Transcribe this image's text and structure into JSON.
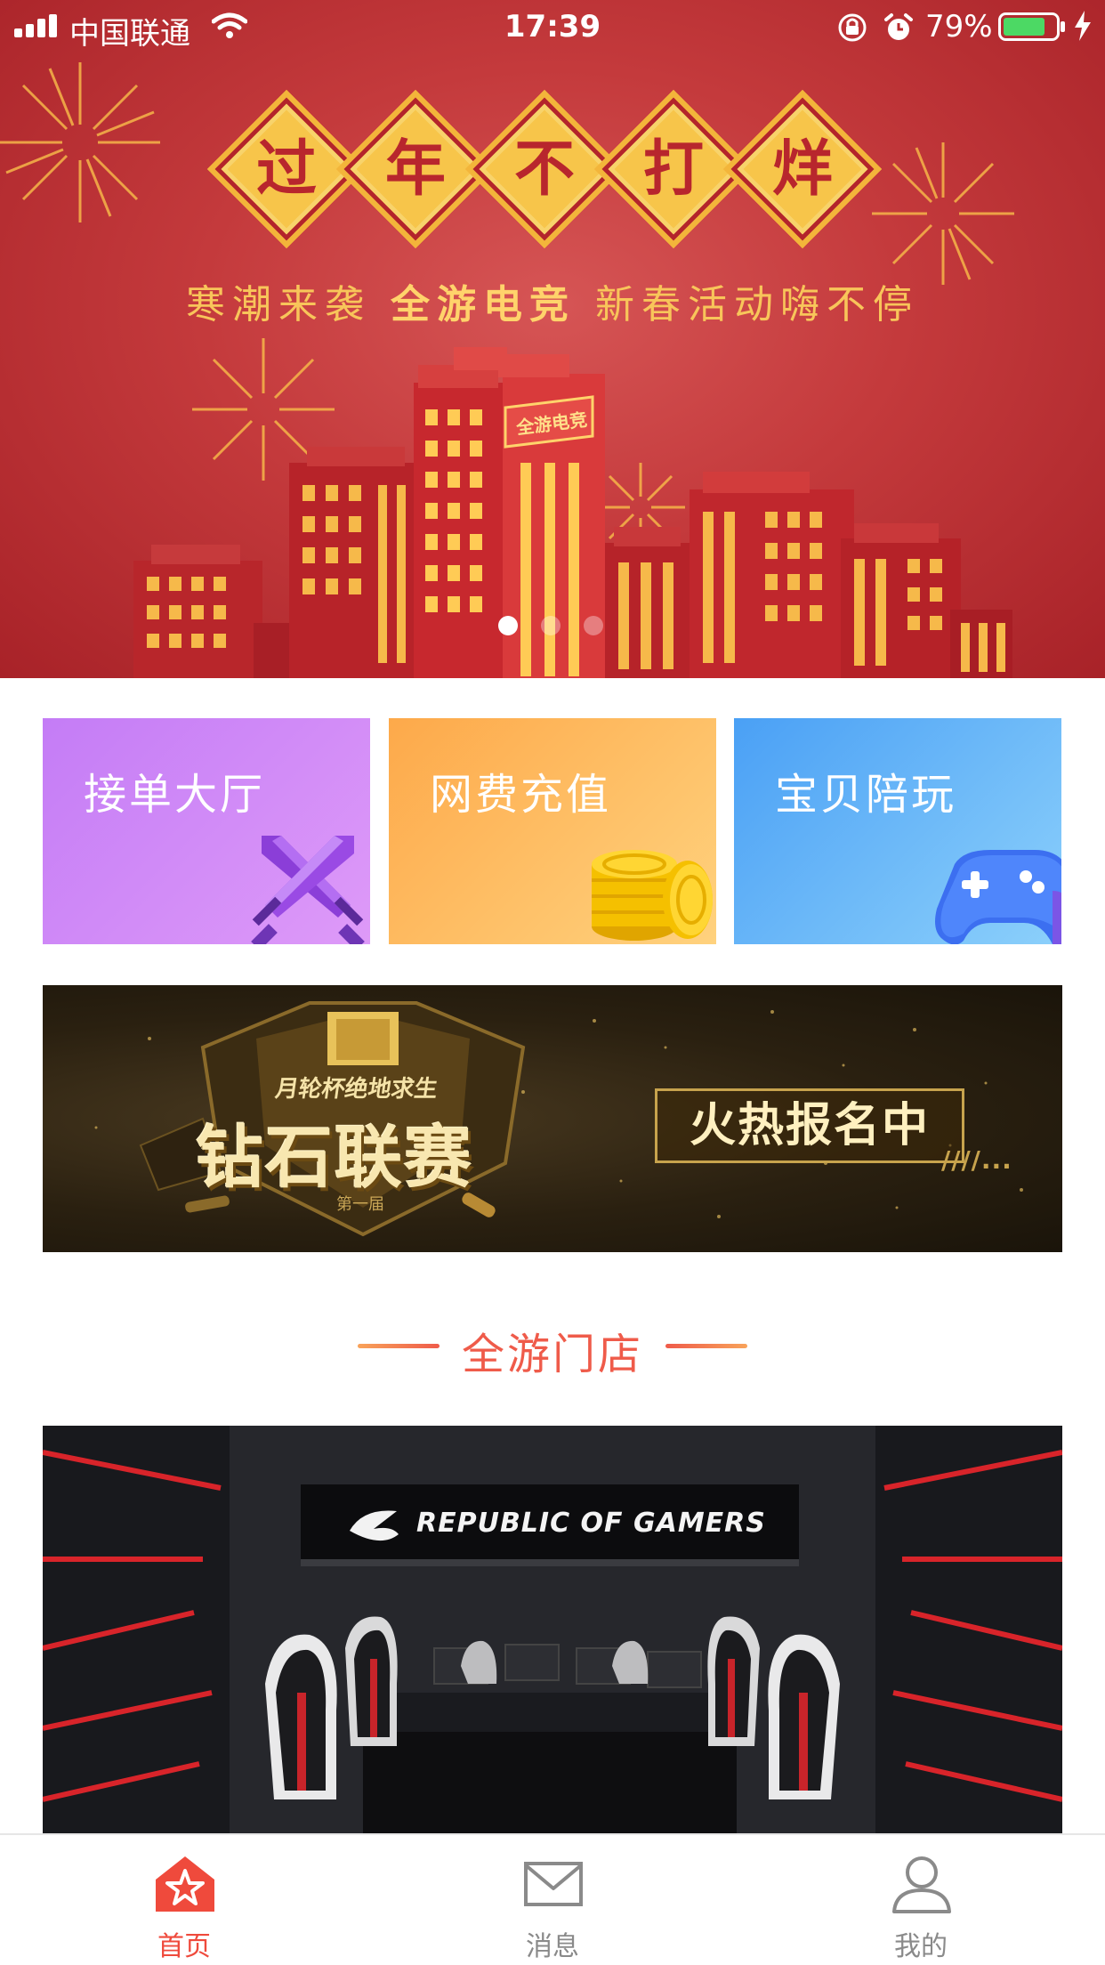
{
  "status_bar": {
    "carrier": "中国联通",
    "time": "17:39",
    "battery": "79%"
  },
  "hero": {
    "title_chars": [
      "过",
      "年",
      "不",
      "打",
      "烊"
    ],
    "subtitle_left": "寒潮来袭",
    "subtitle_brand": "全游电竞",
    "subtitle_right": "新春活动嗨不停",
    "building_sign": "全游电竞",
    "pager_active_index": 0,
    "pager_count": 3
  },
  "features": [
    {
      "label": "接单大厅",
      "icon": "crossed-swords-icon"
    },
    {
      "label": "网费充值",
      "icon": "gold-coins-icon"
    },
    {
      "label": "宝贝陪玩",
      "icon": "gamepad-icon"
    }
  ],
  "promo": {
    "subtitle": "月轮杯绝地求生",
    "title": "钻石联赛",
    "badge": "第一届",
    "cta": "火热报名中",
    "cta_suffix": "////..."
  },
  "section": {
    "title": "全游门店"
  },
  "store": {
    "sign_text": "REPUBLIC OF GAMERS"
  },
  "tabbar": {
    "items": [
      {
        "label": "首页",
        "icon": "home-star-icon",
        "active": true
      },
      {
        "label": "消息",
        "icon": "envelope-icon",
        "active": false
      },
      {
        "label": "我的",
        "icon": "user-icon",
        "active": false
      }
    ]
  },
  "colors": {
    "accent": "#ef4a3c",
    "hero_red": "#c43a3c",
    "gold": "#f7c54a"
  }
}
